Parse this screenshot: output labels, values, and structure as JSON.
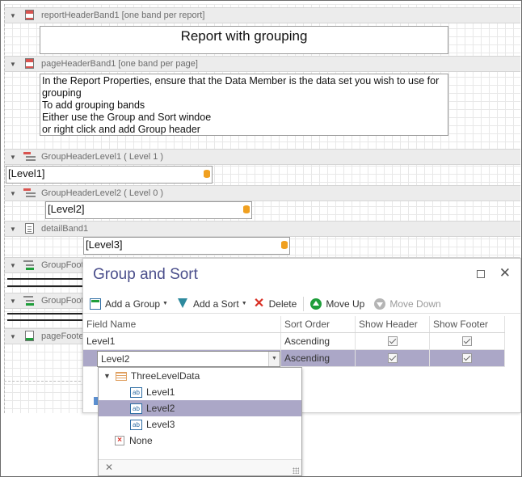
{
  "bands": {
    "report_header": "reportHeaderBand1 [one band per report]",
    "page_header": "pageHeaderBand1 [one band per page]",
    "group_header_1": "GroupHeaderLevel1 ( Level 1 )",
    "group_header_2": "GroupHeaderLevel2 ( Level 0 )",
    "detail": "detailBand1",
    "group_footer_1": "GroupFoote",
    "group_footer_2": "GroupFoote",
    "page_footer": "pageFooter"
  },
  "controls": {
    "report_title": "Report with grouping",
    "instructions": [
      "In the Report Properties, ensure that the Data Member is the data set you wish to use for grouping",
      "To add grouping bands",
      "Either use the Group and Sort windoe",
      "or right click and add Group header"
    ],
    "level1_field": "[Level1]",
    "level2_field": "[Level2]",
    "level3_field": "[Level3]"
  },
  "dialog": {
    "title": "Group and Sort",
    "toolbar": {
      "add_group": "Add a Group",
      "add_sort": "Add a Sort",
      "delete": "Delete",
      "move_up": "Move Up",
      "move_down": "Move Down"
    },
    "columns": [
      "Field Name",
      "Sort Order",
      "Show Header",
      "Show Footer"
    ],
    "rows": [
      {
        "field": "Level1",
        "sort": "Ascending",
        "show_header": true,
        "show_footer": true
      },
      {
        "field": "Level2",
        "sort": "Ascending",
        "show_header": true,
        "show_footer": true
      }
    ]
  },
  "dropdown": {
    "root": "ThreeLevelData",
    "fields": [
      "Level1",
      "Level2",
      "Level3"
    ],
    "selected": "Level2",
    "none_label": "None",
    "field_icon_text": "ab"
  },
  "colors": {
    "selection": "#aba7c7",
    "dialog_title": "#4b4f8c",
    "group_icon": "#d9534f",
    "footer_icon": "#1e9e3a"
  }
}
